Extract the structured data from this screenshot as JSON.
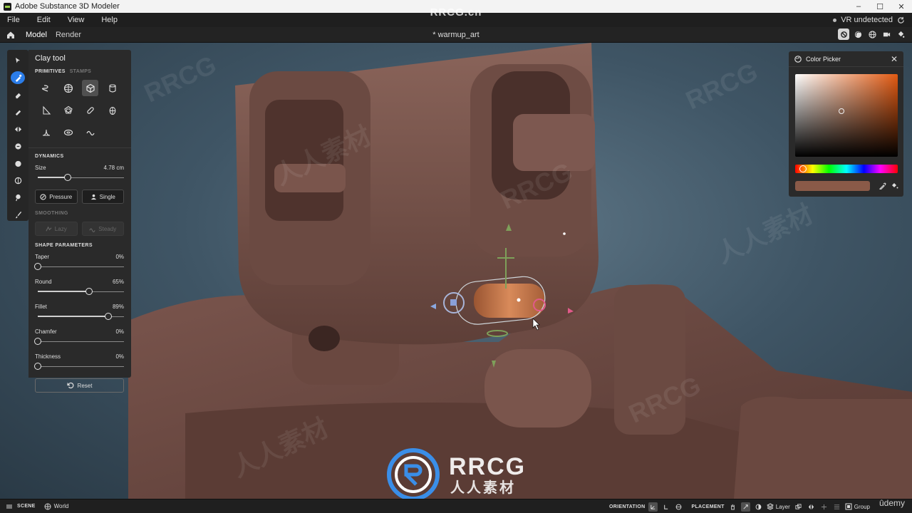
{
  "app": {
    "title": "Adobe Substance 3D Modeler",
    "document": "* warmup_art",
    "window_controls": [
      "–",
      "☐",
      "✕"
    ]
  },
  "menu": {
    "items": [
      "File",
      "Edit",
      "View",
      "Help"
    ],
    "vr_status": "VR undetected"
  },
  "toolbar": {
    "tabs": [
      "Model",
      "Render"
    ],
    "active_tab": "Model"
  },
  "left_rail": {
    "tools": [
      "select-icon",
      "clay-brush-icon",
      "erase-icon",
      "smooth-icon",
      "mirror-icon",
      "move-icon",
      "inflate-icon",
      "crease-icon",
      "pinch-icon",
      "paint-icon"
    ],
    "active_tool": "clay-brush-icon"
  },
  "clay_panel": {
    "title": "Clay tool",
    "tabs": [
      "PRIMITIVES",
      "STAMPS"
    ],
    "primitives": [
      "spring-icon",
      "sphere-icon",
      "cube-icon",
      "cylinder-icon",
      "cone-icon",
      "dodecahedron-icon",
      "capsule-icon",
      "egg-icon",
      "mound-icon",
      "torus-icon",
      "wave-icon"
    ],
    "active_primitive": "cube-icon",
    "dynamics_label": "DYNAMICS",
    "size": {
      "label": "Size",
      "value": "4.78 cm",
      "level": 0.38
    },
    "pressure_label": "Pressure",
    "single_label": "Single",
    "smoothing_label": "SMOOTHING",
    "lazy_label": "Lazy",
    "steady_label": "Steady",
    "shape_params_label": "SHAPE PARAMETERS",
    "params": [
      {
        "label": "Taper",
        "value": "0%",
        "level": 0.0
      },
      {
        "label": "Round",
        "value": "65%",
        "level": 0.65
      },
      {
        "label": "Fillet",
        "value": "89%",
        "level": 0.89
      },
      {
        "label": "Chamfer",
        "value": "0%",
        "level": 0.0
      },
      {
        "label": "Thickness",
        "value": "0%",
        "level": 0.0
      }
    ],
    "reset_label": "Reset"
  },
  "color_picker": {
    "title": "Color Picker",
    "hue_color": "#e25a12",
    "current_color": "#8a5a48",
    "sv_saturation": 0.45,
    "sv_value": 0.55,
    "hue_level": 0.04
  },
  "status": {
    "scene_label": "SCENE",
    "world_label": "World",
    "orientation_label": "ORIENTATION",
    "placement_label": "PLACEMENT",
    "layer_label": "Layer",
    "group_label": "Group"
  },
  "watermarks": {
    "top": "RRCG.cn",
    "logo": "RRCG",
    "logo_sub": "人人素材",
    "udemy": "ûdemy",
    "repeat_a": "RRCG",
    "repeat_b": "人人素材"
  },
  "colors": {
    "accent": "#2b7de9",
    "clay": "#6b4a42",
    "clay_light": "#85615a",
    "clay_dark": "#4a302b",
    "bg_teal": "#4a6272",
    "stroke_orange": "#c07040"
  }
}
